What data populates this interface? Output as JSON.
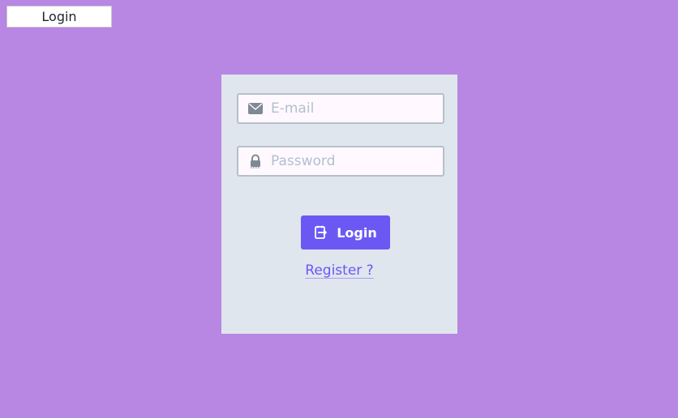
{
  "tab": {
    "label": "Login"
  },
  "form": {
    "email": {
      "value": "",
      "placeholder": "E-mail",
      "icon": "envelope-icon"
    },
    "password": {
      "value": "",
      "placeholder": "Password",
      "icon": "lock-icon"
    },
    "login_button": {
      "label": "Login",
      "icon": "login-icon"
    },
    "register_link": {
      "label": "Register ?"
    }
  },
  "colors": {
    "background": "#b886e3",
    "card": "#dfe6ee",
    "accent": "#6b58f3",
    "input_border": "#b7c0c9",
    "placeholder": "#b2bfcc"
  }
}
